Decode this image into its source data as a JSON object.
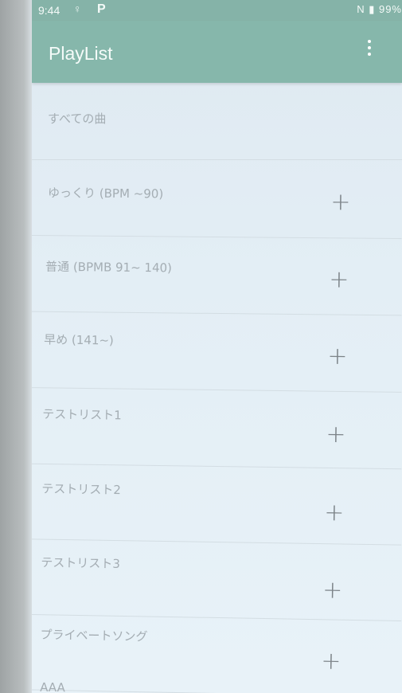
{
  "status_bar": {
    "time": "9:44",
    "right_text": "N  ▮ 99%"
  },
  "app_bar": {
    "title": "PlayList",
    "menu_icon": "overflow-menu-icon"
  },
  "playlists": [
    {
      "label": "すべての曲",
      "has_add": false
    },
    {
      "label": "ゆっくり (BPM ~90)",
      "has_add": true
    },
    {
      "label": "普通 (BPMB 91~ 140)",
      "has_add": true
    },
    {
      "label": "早め (141~)",
      "has_add": true
    },
    {
      "label": "テストリスト1",
      "has_add": true
    },
    {
      "label": "テストリスト2",
      "has_add": true
    },
    {
      "label": "テストリスト3",
      "has_add": true
    },
    {
      "label": "プライベートソング",
      "has_add": true
    },
    {
      "label": "AAA",
      "has_add": false
    }
  ],
  "add_symbol": "+",
  "colors": {
    "toolbar": "#86b7ab",
    "status_bar": "#85b3a8",
    "list_background": "#e3eef5",
    "label_text": "#a4adb3",
    "add_icon": "#7c8388"
  }
}
